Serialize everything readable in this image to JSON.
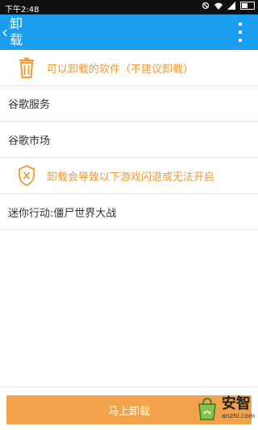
{
  "status_bar": {
    "time": "下午2:48"
  },
  "header": {
    "back_symbol": "‹",
    "title": "卸载"
  },
  "sections": [
    {
      "text": "可以卸载的软件（不建议卸载）",
      "icon": "trash-icon",
      "items": [
        "谷歌服务",
        "谷歌市场"
      ]
    },
    {
      "text": "卸载会导致以下游戏闪退或无法开启",
      "icon": "warning-shield-icon",
      "items": [
        "迷你行动:僵尸世界大战"
      ]
    }
  ],
  "action": {
    "uninstall_label": "马上卸载"
  },
  "watermark": {
    "cn": "安智",
    "en": "anzhi.com"
  },
  "colors": {
    "header": "#1b9df0",
    "accent": "#f09b33",
    "button": "#f2a24a"
  }
}
